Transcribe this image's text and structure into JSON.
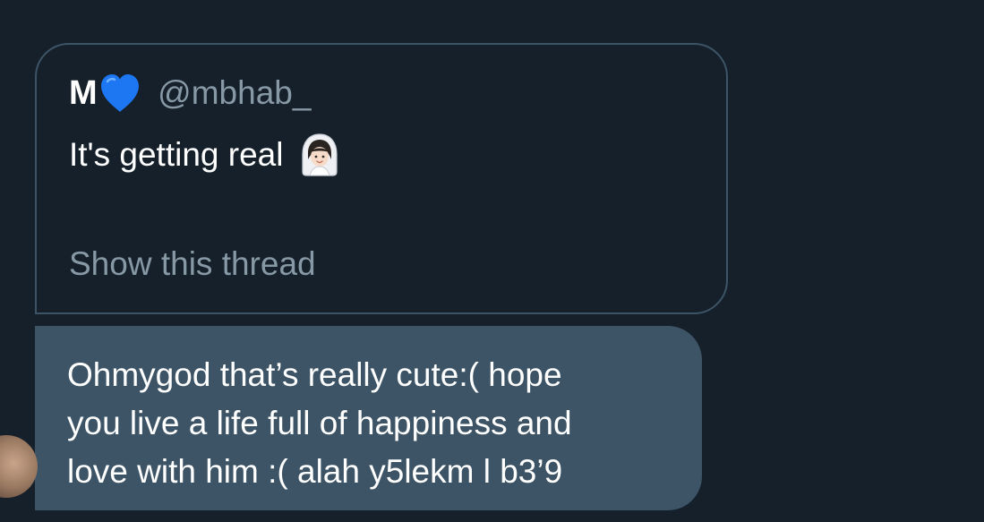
{
  "quoted_tweet": {
    "author_name": "M",
    "author_handle": "@mbhab_",
    "text": "It's getting real",
    "name_icon": "blue-heart-icon",
    "text_icon": "bride-with-veil-icon",
    "show_thread_label": "Show this thread"
  },
  "message": {
    "lines": [
      "Ohmygod that’s really cute:( hope",
      "you live a life full of happiness and",
      "love with him :( alah y5lekm l b3’9"
    ]
  },
  "colors": {
    "background": "#15202b",
    "card_border": "#3d5466",
    "bubble": "#3d5466",
    "secondary_text": "#8899a6",
    "heart": "#1d76f2"
  }
}
